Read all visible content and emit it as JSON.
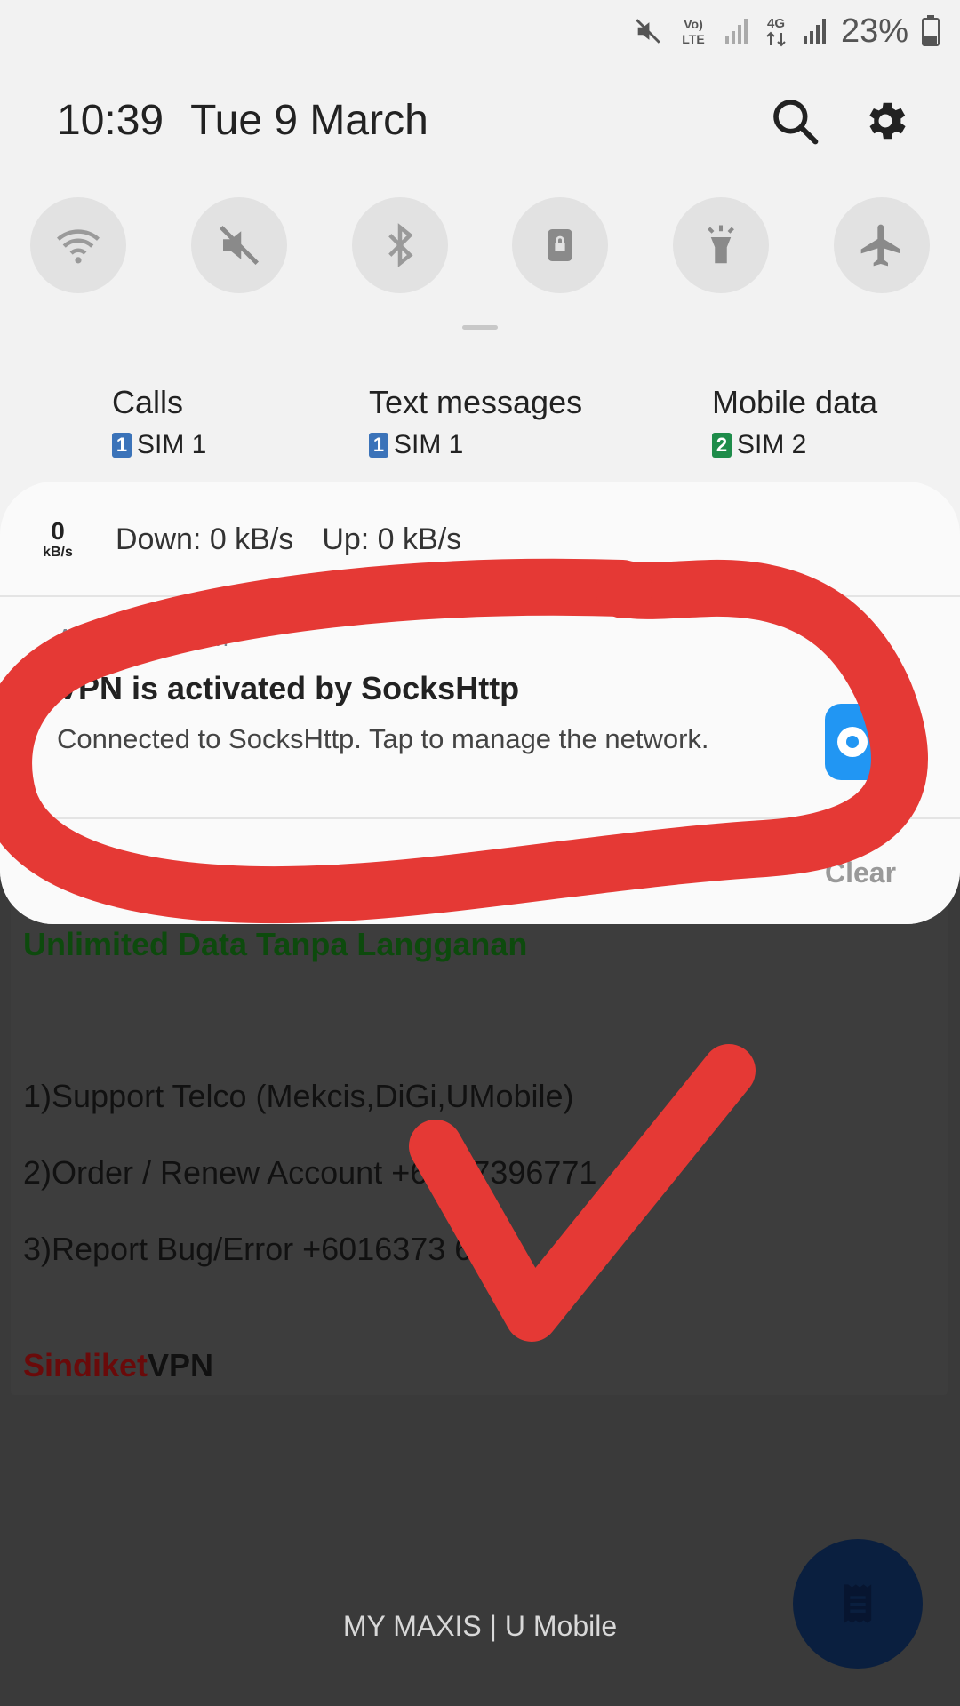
{
  "status_bar": {
    "battery": "23%",
    "icons": [
      "mute-icon",
      "volte-icon",
      "signal-icon",
      "4g-icon",
      "signal-icon",
      "battery-icon"
    ]
  },
  "header": {
    "time": "10:39",
    "date": "Tue 9 March"
  },
  "quick_toggles": [
    "wifi-icon",
    "sound-off-icon",
    "bluetooth-icon",
    "rotation-lock-icon",
    "flashlight-icon",
    "airplane-mode-icon"
  ],
  "sim_settings": [
    {
      "title": "Calls",
      "badge": "1",
      "sim": "SIM 1",
      "color": "#3b73b9"
    },
    {
      "title": "Text messages",
      "badge": "1",
      "sim": "SIM 1",
      "color": "#3b73b9"
    },
    {
      "title": "Mobile data",
      "badge": "2",
      "sim": "SIM 2",
      "color": "#1e8c4a"
    }
  ],
  "speed": {
    "value": "0",
    "unit": "kB/s",
    "down": "Down: 0 kB/s",
    "up": "Up: 0 kB/s"
  },
  "notification": {
    "app": "Android system",
    "title": "VPN is activated by SocksHttp",
    "body": "Connected to SocksHttp. Tap to manage the network."
  },
  "panel_actions": {
    "settings": "Noti",
    "clear": "Clear"
  },
  "app_content": {
    "headline": "Unlimited Data Tanpa Langganan",
    "line1": "1)Support Telco (Mekcis,DiGi,UMobile)",
    "line2": "2)Order / Renew Account +6  137396771",
    "line3": "3)Report Bug/Error +6016373  64",
    "brand_a": "Sindiket",
    "brand_b": "VPN",
    "footer": "MY MAXIS | U Mobile"
  },
  "colors": {
    "annotation_red": "#e53935",
    "accent_blue": "#2196f3"
  }
}
